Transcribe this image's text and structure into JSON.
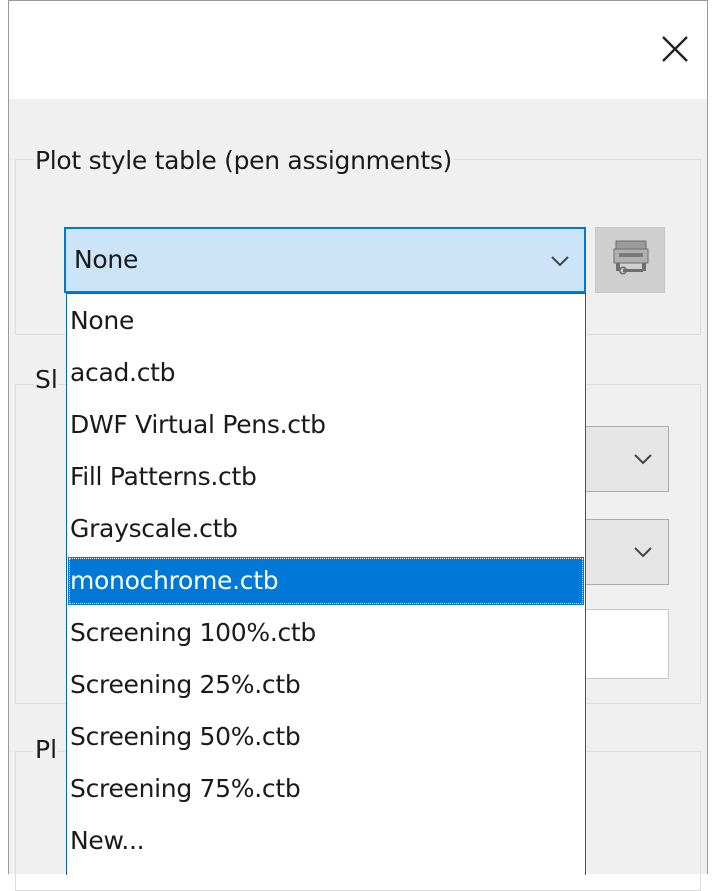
{
  "dialog": {
    "close_label": "×",
    "plot_style_group": {
      "title": "Plot style table (pen assignments)",
      "selected_value": "None",
      "options": [
        "None",
        "acad.ctb",
        "DWF Virtual Pens.ctb",
        "Fill Patterns.ctb",
        "Grayscale.ctb",
        "monochrome.ctb",
        "Screening 100%.ctb",
        "Screening 25%.ctb",
        "Screening 50%.ctb",
        "Screening 75%.ctb",
        "New..."
      ],
      "highlighted_option": "monochrome.ctb"
    },
    "shaded_group": {
      "title_fragment": "Sl"
    },
    "plot_options_group": {
      "title_fragment": "Pl"
    }
  },
  "colors": {
    "accent": "#0078d7",
    "combo_focus_bg": "#cce4f7",
    "dialog_bg": "#f0f0f0"
  },
  "icons": {
    "close": "close-icon",
    "dropdown": "chevron-down-icon",
    "edit": "plot-style-editor-icon"
  }
}
